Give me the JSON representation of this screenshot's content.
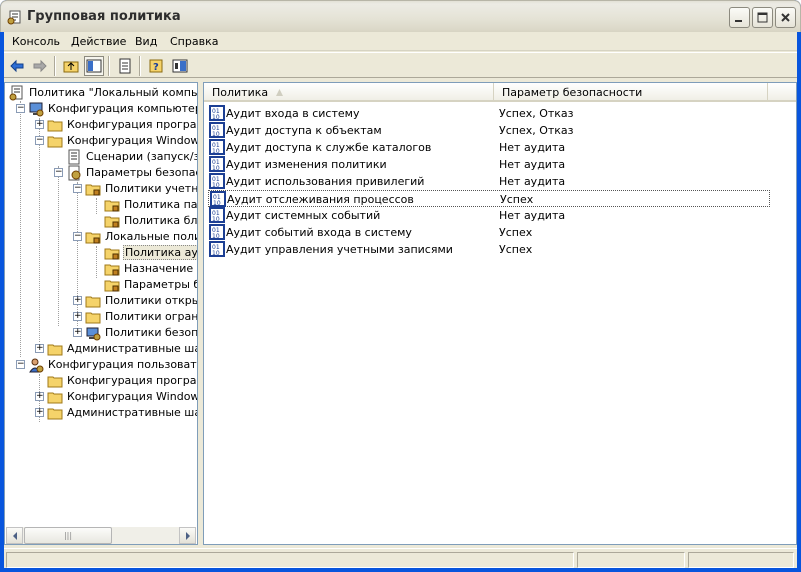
{
  "window": {
    "title": "Групповая политика"
  },
  "menu": [
    {
      "label": "Консоль"
    },
    {
      "label": "Действие"
    },
    {
      "label": "Вид"
    },
    {
      "label": "Справка"
    }
  ],
  "toolbar": {
    "icons": [
      "back-arrow-icon",
      "forward-arrow-icon",
      "up-folder-icon",
      "show-hide-tree-icon",
      "export-list-icon",
      "help-icon",
      "properties-icon"
    ]
  },
  "tree": {
    "root": "Политика \"Локальный компьютер\"",
    "items": [
      {
        "label": "Конфигурация компьютера"
      },
      {
        "label": "Конфигурация программ"
      },
      {
        "label": "Конфигурация Windows"
      },
      {
        "label": "Сценарии (запуск/завершение)"
      },
      {
        "label": "Параметры безопасности"
      },
      {
        "label": "Политики учетных записей"
      },
      {
        "label": "Политика паролей"
      },
      {
        "label": "Политика блокировки учетных записей"
      },
      {
        "label": "Локальные политики"
      },
      {
        "label": "Политика аудита"
      },
      {
        "label": "Назначение прав пользователя"
      },
      {
        "label": "Параметры безопасности"
      },
      {
        "label": "Политики открытого ключа"
      },
      {
        "label": "Политики ограниченного использования программ"
      },
      {
        "label": "Политики безопасности IP"
      },
      {
        "label": "Административные шаблоны"
      },
      {
        "label": "Конфигурация пользователя"
      },
      {
        "label": "Конфигурация программ"
      },
      {
        "label": "Конфигурация Windows"
      },
      {
        "label": "Административные шаблоны"
      }
    ]
  },
  "list": {
    "columns": [
      "Политика",
      "Параметр безопасности"
    ],
    "rows": [
      {
        "policy": "Аудит входа в систему",
        "setting": "Успех, Отказ"
      },
      {
        "policy": "Аудит доступа к объектам",
        "setting": "Успех, Отказ"
      },
      {
        "policy": "Аудит доступа к службе каталогов",
        "setting": "Нет аудита"
      },
      {
        "policy": "Аудит изменения политики",
        "setting": "Нет аудита"
      },
      {
        "policy": "Аудит использования привилегий",
        "setting": "Нет аудита"
      },
      {
        "policy": "Аудит отслеживания процессов",
        "setting": "Успех"
      },
      {
        "policy": "Аудит системных событий",
        "setting": "Нет аудита"
      },
      {
        "policy": "Аудит событий входа в систему",
        "setting": "Успех"
      },
      {
        "policy": "Аудит управления учетными записями",
        "setting": "Успех"
      }
    ]
  },
  "colors": {
    "titlebar": "#e6e4d8",
    "face": "#ece9d8",
    "border": "#7f9db9",
    "accent": "#0855dd"
  }
}
